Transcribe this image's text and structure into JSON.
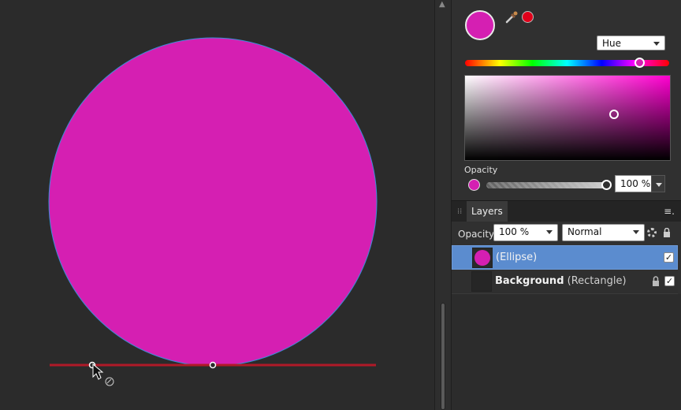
{
  "colors": {
    "fill": "#d51fb2",
    "stroke": "#3a8fd8",
    "line": "#b01a28",
    "canvas_bg": "#2b2b2b",
    "selected_row": "#5b8ccf",
    "secondary_swatch": "#e0001a"
  },
  "color_panel": {
    "mode": "Hue",
    "hue_position": 0.86,
    "opacity_label": "Opacity",
    "opacity_value": "100 %",
    "opacity_level": 1.0
  },
  "layers_panel": {
    "tab_label": "Layers",
    "opacity_label": "Opacity:",
    "opacity_value": "100 %",
    "blend_mode": "Normal",
    "layers": [
      {
        "name": "(Ellipse)",
        "selected": true,
        "visible": true,
        "locked": false
      },
      {
        "name_bold": "Background",
        "name_rest": "(Rectangle)",
        "selected": false,
        "visible": true,
        "locked": true
      }
    ]
  },
  "icons": {
    "eyedropper": "eyedropper-icon",
    "gear": "gear-icon",
    "lock": "lock-icon",
    "menu": "panel-menu-icon",
    "cursor": "arrow-cursor-icon"
  }
}
